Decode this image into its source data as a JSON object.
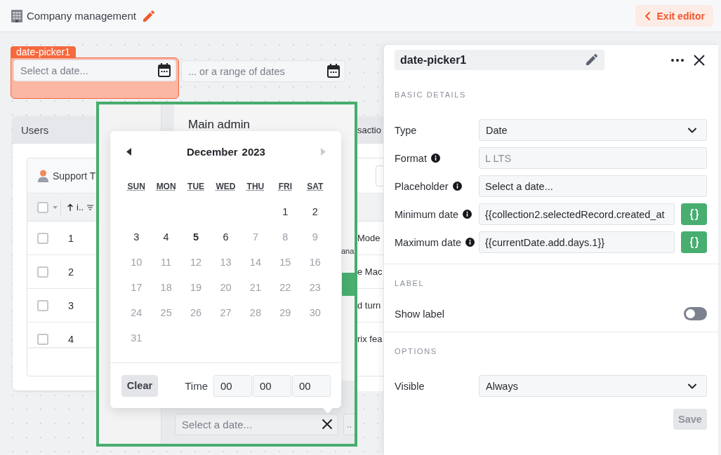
{
  "header": {
    "title": "Company management",
    "exit_button": "Exit editor"
  },
  "canvas": {
    "selected_widget": {
      "tag": "date-picker1",
      "placeholder": "Select a date..."
    },
    "range_picker": {
      "placeholder": "... or a range of dates"
    },
    "users_card": {
      "title": "Users",
      "table": {
        "title": "Support T",
        "select_all_checked": false,
        "columns": [
          {
            "label": "i.."
          }
        ],
        "rows": [
          {
            "checked": false,
            "cells": [
              "1"
            ]
          },
          {
            "checked": false,
            "cells": [
              "2"
            ]
          },
          {
            "checked": false,
            "cells": [
              "3"
            ]
          },
          {
            "checked": false,
            "cells": [
              "4"
            ]
          }
        ]
      }
    },
    "transactions_card": {
      "title": "sactio",
      "rows": [
        "Mode",
        "e Mac",
        "d turn",
        "rix fea"
      ]
    },
    "preview_frame": {
      "title": "Main admin",
      "text_fragment": "ana",
      "date_input": {
        "placeholder": "Select a date..."
      },
      "range_input": {
        "placeholder": ".."
      }
    }
  },
  "calendar": {
    "month": "December",
    "year": "2023",
    "prev_enabled": true,
    "next_enabled": false,
    "weekdays": [
      "SUN",
      "MON",
      "TUE",
      "WED",
      "THU",
      "FRI",
      "SAT"
    ],
    "weeks": [
      [
        {
          "label": "1",
          "disabled": false,
          "today": false
        },
        {
          "label": "2",
          "disabled": false,
          "today": false
        }
      ],
      [
        {
          "label": "3",
          "disabled": false,
          "today": false
        },
        {
          "label": "4",
          "disabled": false,
          "today": false
        },
        {
          "label": "5",
          "disabled": false,
          "today": true
        },
        {
          "label": "6",
          "disabled": false,
          "today": false
        },
        {
          "label": "7",
          "disabled": true,
          "today": false
        },
        {
          "label": "8",
          "disabled": true,
          "today": false
        },
        {
          "label": "9",
          "disabled": true,
          "today": false
        }
      ],
      [
        {
          "label": "10",
          "disabled": true,
          "today": false
        },
        {
          "label": "11",
          "disabled": true,
          "today": false
        },
        {
          "label": "12",
          "disabled": true,
          "today": false
        },
        {
          "label": "13",
          "disabled": true,
          "today": false
        },
        {
          "label": "14",
          "disabled": true,
          "today": false
        },
        {
          "label": "15",
          "disabled": true,
          "today": false
        },
        {
          "label": "16",
          "disabled": true,
          "today": false
        }
      ],
      [
        {
          "label": "17",
          "disabled": true,
          "today": false
        },
        {
          "label": "18",
          "disabled": true,
          "today": false
        },
        {
          "label": "19",
          "disabled": true,
          "today": false
        },
        {
          "label": "20",
          "disabled": true,
          "today": false
        },
        {
          "label": "21",
          "disabled": true,
          "today": false
        },
        {
          "label": "22",
          "disabled": true,
          "today": false
        },
        {
          "label": "23",
          "disabled": true,
          "today": false
        }
      ],
      [
        {
          "label": "24",
          "disabled": true,
          "today": false
        },
        {
          "label": "25",
          "disabled": true,
          "today": false
        },
        {
          "label": "26",
          "disabled": true,
          "today": false
        },
        {
          "label": "27",
          "disabled": true,
          "today": false
        },
        {
          "label": "28",
          "disabled": true,
          "today": false
        },
        {
          "label": "29",
          "disabled": true,
          "today": false
        },
        {
          "label": "30",
          "disabled": true,
          "today": false
        }
      ],
      [
        {
          "label": "31",
          "disabled": true,
          "today": false
        }
      ]
    ],
    "clear_button": "Clear",
    "time": {
      "label": "Time",
      "fields": [
        "00",
        "00",
        "00"
      ]
    }
  },
  "inspector": {
    "name": "date-picker1",
    "sections": [
      {
        "title": "BASIC DETAILS",
        "rows": [
          {
            "kind": "select",
            "label": "Type",
            "info": false,
            "value": "Date"
          },
          {
            "kind": "text",
            "label": "Format",
            "info": true,
            "placeholder": "L LTS"
          },
          {
            "kind": "text",
            "label": "Placeholder",
            "info": true,
            "value": "Select a date..."
          },
          {
            "kind": "code",
            "label": "Minimum date",
            "info": true,
            "value": "{{collection2.selectedRecord.created_at"
          },
          {
            "kind": "code",
            "label": "Maximum date",
            "info": true,
            "value": "{{currentDate.add.days.1}}"
          }
        ]
      },
      {
        "title": "LABEL",
        "rows": [
          {
            "kind": "toggle",
            "label": "Show label",
            "info": false,
            "on": false
          }
        ]
      },
      {
        "title": "OPTIONS",
        "rows": [
          {
            "kind": "select",
            "label": "Visible",
            "info": false,
            "value": "Always"
          }
        ]
      }
    ],
    "save_button": {
      "label": "Save",
      "disabled": true
    }
  }
}
